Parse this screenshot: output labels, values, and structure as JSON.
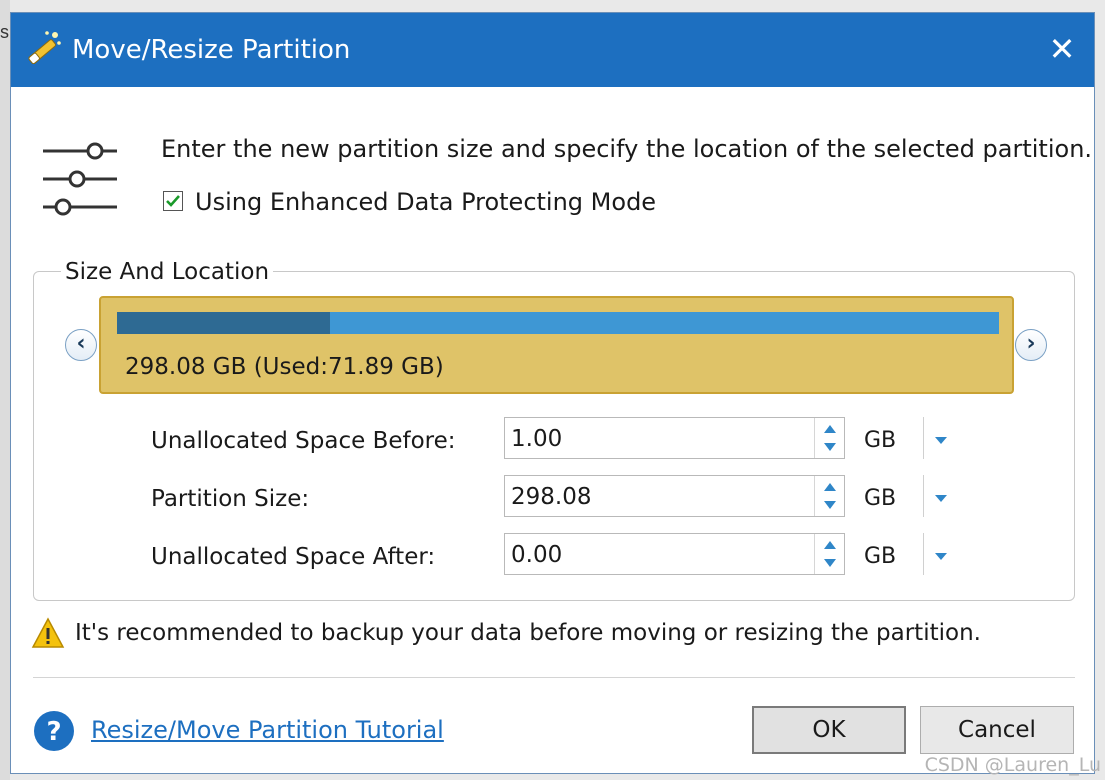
{
  "window": {
    "title": "Move/Resize Partition",
    "close_glyph": "✕",
    "app_icon": "magic-wand-icon"
  },
  "intro": {
    "icon": "sliders-icon",
    "text": "Enter the new partition size and specify the location of the selected partition.",
    "checkbox_label": "Using Enhanced Data Protecting Mode",
    "checkbox_checked": true
  },
  "size_location": {
    "title": "Size And Location",
    "nav_left_glyph": "‹",
    "nav_right_glyph": "›",
    "partition_label": "298.08 GB (Used:71.89 GB)",
    "used_fraction": 0.2412
  },
  "fields": [
    {
      "label": "Unallocated Space Before:",
      "value": "1.00",
      "unit": "GB"
    },
    {
      "label": "Partition Size:",
      "value": "298.08",
      "unit": "GB"
    },
    {
      "label": "Unallocated Space After:",
      "value": "0.00",
      "unit": "GB"
    }
  ],
  "warning": {
    "icon": "warning-icon",
    "text": "It's recommended to backup your data before moving or resizing the partition."
  },
  "footer": {
    "help_icon": "help-icon",
    "tutorial_link": "Resize/Move Partition Tutorial",
    "ok_label": "OK",
    "cancel_label": "Cancel"
  },
  "watermark": "CSDN @Lauren_Lu",
  "colors": {
    "titlebar": "#1d6fc0",
    "partition_bg": "#dfc368",
    "bar_free": "#3e97d4",
    "bar_used": "#2e6a93",
    "link": "#1d6fc0"
  }
}
